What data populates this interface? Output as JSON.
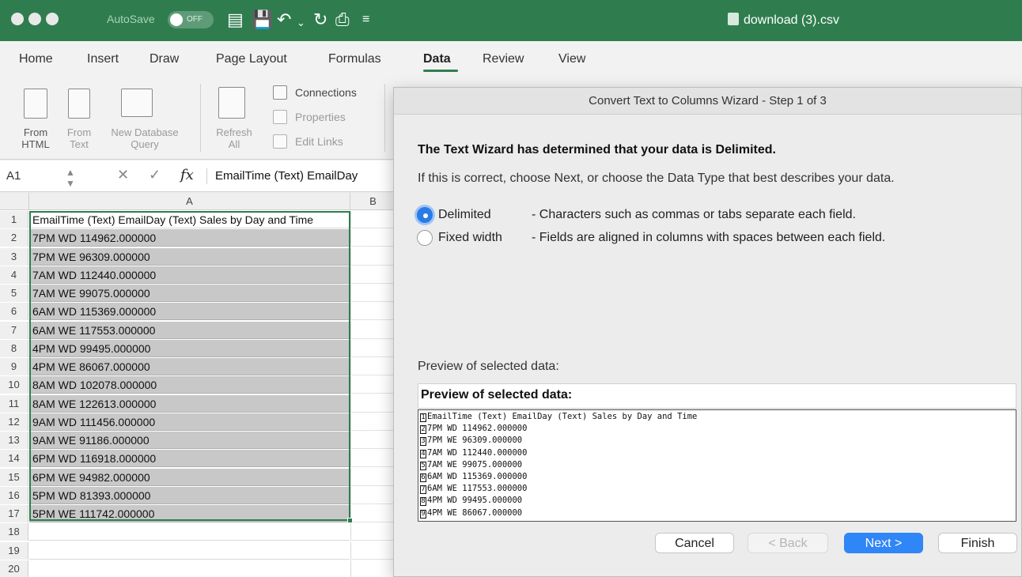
{
  "titlebar": {
    "autosave_label": "AutoSave",
    "autosave_state": "OFF",
    "document_title": "download (3).csv",
    "accent_color": "#2f7d4f"
  },
  "menu": {
    "tabs": [
      "Home",
      "Insert",
      "Draw",
      "Page Layout",
      "Formulas",
      "Data",
      "Review",
      "View"
    ],
    "active_tab": "Data"
  },
  "ribbon": {
    "from_html": "From\nHTML",
    "from_html_line1": "From",
    "from_html_line2": "HTML",
    "from_text_line1": "From",
    "from_text_line2": "Text",
    "new_db_line1": "New Database",
    "new_db_line2": "Query",
    "refresh_line1": "Refresh",
    "refresh_line2": "All",
    "connections": "Connections",
    "properties": "Properties",
    "edit_links": "Edit Links"
  },
  "formula_bar": {
    "name_box": "A1",
    "fx_label": "fx",
    "content": "EmailTime (Text)   EmailDay"
  },
  "sheet": {
    "col_a": "A",
    "col_b": "B",
    "row_numbers": [
      "1",
      "2",
      "3",
      "4",
      "5",
      "6",
      "7",
      "8",
      "9",
      "10",
      "11",
      "12",
      "13",
      "14",
      "15",
      "16",
      "17",
      "18",
      "19",
      "20"
    ],
    "cells_a": [
      "EmailTime (Text) EmailDay (Text) Sales by Day and Time",
      "7PM WD 114962.000000",
      "7PM WE 96309.000000",
      "7AM WD 112440.000000",
      "7AM WE 99075.000000",
      "6AM WD 115369.000000",
      "6AM WE 117553.000000",
      "4PM WD 99495.000000",
      "4PM WE 86067.000000",
      "8AM WD 102078.000000",
      "8AM WE 122613.000000",
      "9AM WD 111456.000000",
      "9AM WE 91186.000000",
      "6PM WD 116918.000000",
      "6PM WE 94982.000000",
      "5PM WD 81393.000000",
      "5PM WE 111742.000000",
      "",
      "",
      ""
    ]
  },
  "dialog": {
    "title": "Convert Text to Columns Wizard - Step 1 of 3",
    "heading": "The Text Wizard has determined that your data is Delimited.",
    "subheading": "If this is correct, choose Next, or choose the Data Type that best describes your data.",
    "options": [
      {
        "label": "Delimited",
        "desc": "- Characters such as commas or tabs separate each field.",
        "selected": true
      },
      {
        "label": "Fixed width",
        "desc": "- Fields are aligned in columns with spaces between each field.",
        "selected": false
      }
    ],
    "preview_label": "Preview of selected data:",
    "preview_heading": "Preview of selected data:",
    "preview_rows": [
      {
        "n": "1",
        "text": "EmailTime (Text) EmailDay (Text) Sales by Day and Time"
      },
      {
        "n": "2",
        "text": "7PM WD 114962.000000"
      },
      {
        "n": "3",
        "text": "7PM WE 96309.000000"
      },
      {
        "n": "4",
        "text": "7AM WD 112440.000000"
      },
      {
        "n": "5",
        "text": "7AM WE 99075.000000"
      },
      {
        "n": "6",
        "text": "6AM WD 115369.000000"
      },
      {
        "n": "7",
        "text": "6AM WE 117553.000000"
      },
      {
        "n": "8",
        "text": "4PM WD 99495.000000"
      },
      {
        "n": "9",
        "text": "4PM WE 86067.000000"
      }
    ],
    "buttons": {
      "cancel": "Cancel",
      "back": "< Back",
      "next": "Next >",
      "finish": "Finish"
    }
  }
}
